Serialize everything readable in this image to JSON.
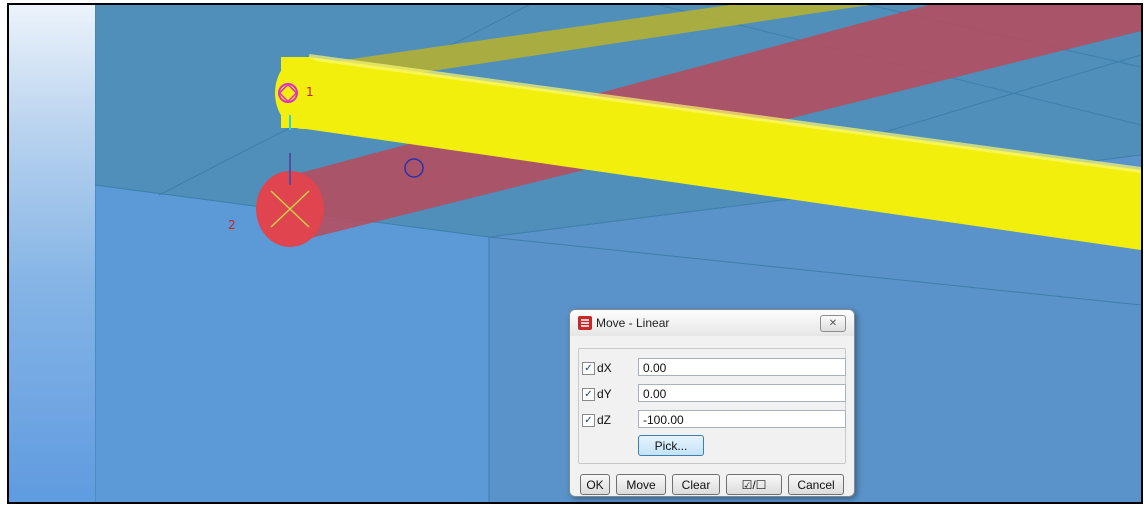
{
  "viewport": {
    "point_labels": [
      "1",
      "2"
    ],
    "colors": {
      "background": "#5e9fd3",
      "yellow_pipe": "#f5f000",
      "red_pipe": "#d24050",
      "olive_pipe": "#b8b32c",
      "grid_line": "#3d7eaa"
    }
  },
  "dialog": {
    "title": "Move - Linear",
    "icon": "app-logo-icon",
    "close_icon": "close-icon",
    "rows": [
      {
        "label": "dX",
        "checked": true,
        "value": "0.00"
      },
      {
        "label": "dY",
        "checked": true,
        "value": "0.00"
      },
      {
        "label": "dZ",
        "checked": true,
        "value": "-100.00"
      }
    ],
    "pick_label": "Pick...",
    "buttons": {
      "ok": "OK",
      "move": "Move",
      "clear": "Clear",
      "toggle": "☑/☐",
      "cancel": "Cancel"
    }
  }
}
